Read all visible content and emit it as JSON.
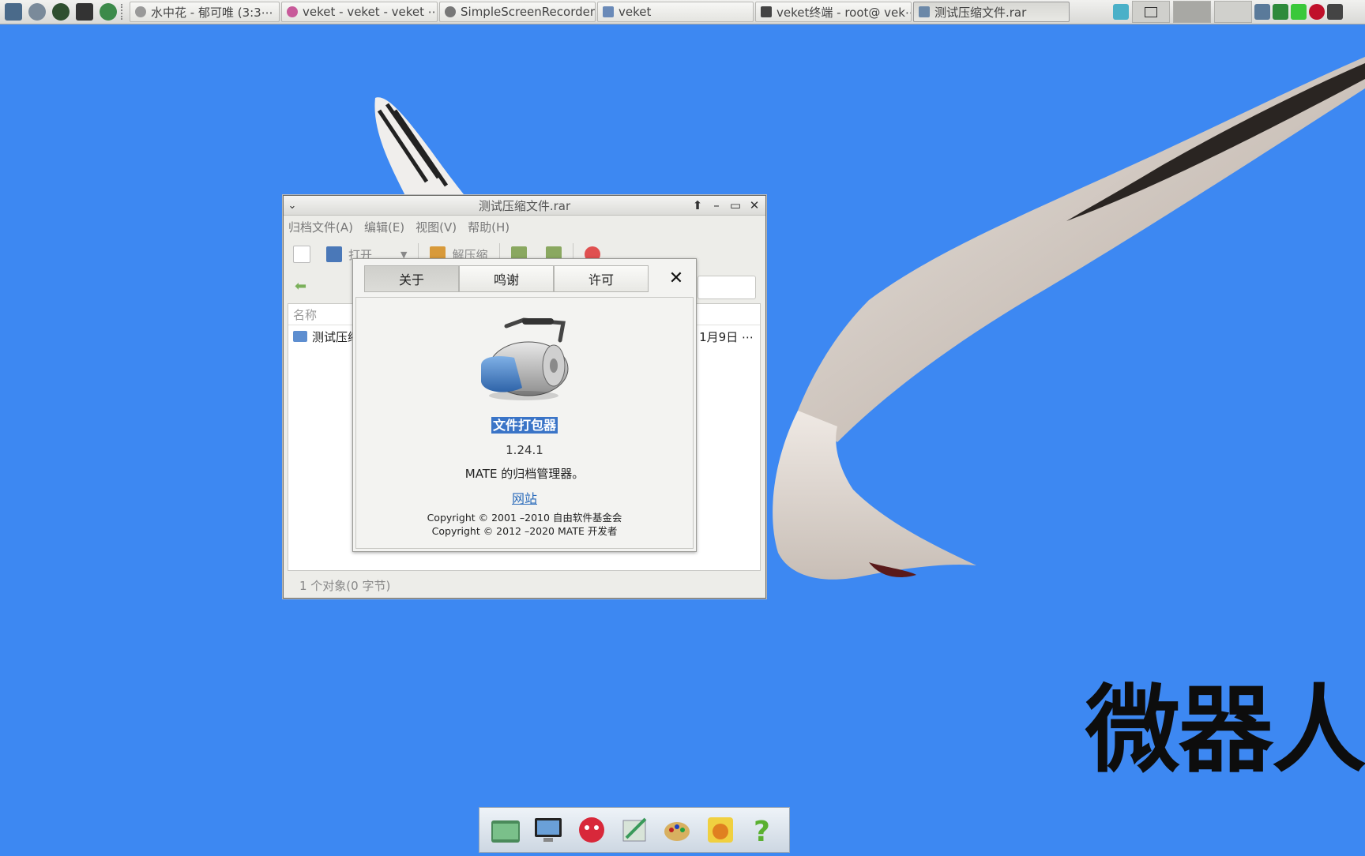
{
  "top_panel": {
    "launchers": [
      "system-monitor-icon",
      "settings-icon",
      "media-play-icon",
      "terminal-icon",
      "browser-icon"
    ],
    "tasks": [
      {
        "label": "水中花 - 郁可唯 (3:3⋯",
        "icon": "music-icon"
      },
      {
        "label": "veket - veket - veket ⋯",
        "icon": "browser-icon"
      },
      {
        "label": "SimpleScreenRecorder",
        "icon": "recorder-icon"
      },
      {
        "label": "veket",
        "icon": "folder-icon"
      },
      {
        "label": "veket终端 - root@ vek⋯",
        "icon": "terminal-icon"
      },
      {
        "label": "测试压缩文件.rar",
        "icon": "archive-icon"
      }
    ]
  },
  "archive_window": {
    "title": "测试压缩文件.rar",
    "menu": [
      "归档文件(A)",
      "编辑(E)",
      "视图(V)",
      "帮助(H)"
    ],
    "toolbar": {
      "open_label": "打开",
      "extract_label": "解压缩"
    },
    "column_name": "名称",
    "rows": [
      {
        "name": "测试压缩",
        "date": "1月9日 ⋯"
      }
    ],
    "status": "1 个对象(0 字节)"
  },
  "about_dialog": {
    "tabs": [
      "关于",
      "鸣谢",
      "许可"
    ],
    "selected_tab": "关于",
    "program_name": "文件打包器",
    "version": "1.24.1",
    "comment": "MATE 的归档管理器。",
    "website_label": "网站",
    "copyright_1": "Copyright © 2001 –2010 自由软件基金会",
    "copyright_2": "Copyright © 2012 –2020 MATE 开发者"
  },
  "desktop": {
    "watermark": "微器人",
    "background_color": "#3d88f2"
  },
  "dock": {
    "items": [
      "file-manager-icon",
      "screen-settings-icon",
      "mascot-icon",
      "editor-icon",
      "paint-icon",
      "veket-icon",
      "help-icon"
    ]
  }
}
